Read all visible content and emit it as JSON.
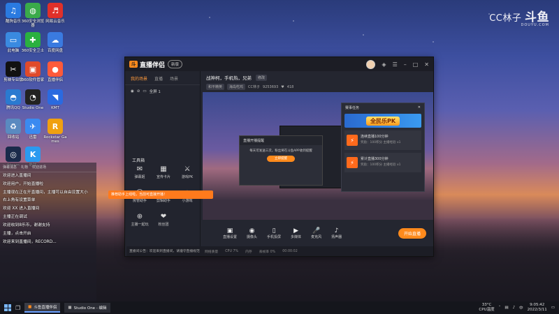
{
  "watermark": {
    "channel": "CC林子",
    "brand": "斗鱼",
    "domain": "DOUYU.COM"
  },
  "desktop_icons": [
    {
      "label": "酷狗音乐",
      "icon": "music-icon",
      "color": "#2a7ae0"
    },
    {
      "label": "360安全浏览器",
      "icon": "browser-icon",
      "color": "#3aaa4a"
    },
    {
      "label": "网易云音乐",
      "icon": "cloud-music-icon",
      "color": "#e0302a"
    },
    {
      "label": "此电脑",
      "icon": "computer-icon",
      "color": "#3a8ae0"
    },
    {
      "label": "360安全卫士",
      "icon": "shield-icon",
      "color": "#2ab040"
    },
    {
      "label": "百度网盘",
      "icon": "netdisk-icon",
      "color": "#3a7ae0"
    },
    {
      "label": "剪映专业版",
      "icon": "video-edit-icon",
      "color": "#111111"
    },
    {
      "label": "360软件管家",
      "icon": "app-store-icon",
      "color": "#e04a2a"
    },
    {
      "label": "直播伴侣",
      "icon": "live-icon",
      "color": "#ff5a3a"
    },
    {
      "label": "腾讯QQ",
      "icon": "qq-icon",
      "color": "#2a7ad0"
    },
    {
      "label": "Studio One",
      "icon": "studio-icon",
      "color": "#222222"
    },
    {
      "label": "KMT",
      "icon": "kmt-icon",
      "color": "#2a6ae0"
    },
    {
      "label": "回收站",
      "icon": "recycle-bin-icon",
      "color": "#5a8ac0"
    },
    {
      "label": "迅雷",
      "icon": "thunder-icon",
      "color": "#3a8af0"
    },
    {
      "label": "Rockstar Games",
      "icon": "rockstar-icon",
      "color": "#f0a010"
    },
    {
      "label": "Steam",
      "icon": "steam-icon",
      "color": "#1a2a4a"
    },
    {
      "label": "酷我",
      "icon": "kuwo-icon",
      "color": "#2a9af0"
    }
  ],
  "main_window": {
    "app_name": "直播伴侣",
    "version_badge": "新版",
    "left_tabs": [
      "我的场景",
      "直播",
      "场景"
    ],
    "scene_label": "全屏 1",
    "tools_title": "工具箱",
    "tools": [
      {
        "label": "弹幕姬",
        "icon": "danmaku-icon"
      },
      {
        "label": "宣传卡片",
        "icon": "card-icon"
      },
      {
        "label": "游戏PK",
        "icon": "pk-icon"
      },
      {
        "label": "房管助手",
        "icon": "manager-icon"
      },
      {
        "label": "剪辑助手",
        "icon": "clip-icon"
      },
      {
        "label": "小游戏",
        "icon": "game-icon"
      },
      {
        "label": "主播一起玩",
        "icon": "together-icon"
      },
      {
        "label": "粉丝团",
        "icon": "fans-icon"
      }
    ],
    "stream_title": "战神柯，手机热，兄弟",
    "edit_label": "修改",
    "tags": [
      "和平精英",
      "海岛吃鸡"
    ],
    "room_info": "CC林子",
    "room_id": "9253693",
    "viewer_count": "418",
    "dialog": {
      "title": "直播开播提醒",
      "body": "每天可发送三次，粉丝将在斗鱼APP收到提醒",
      "button": "立即提醒"
    },
    "rank_panel": {
      "title": "赛事任务",
      "banner": "全民乐PK",
      "tasks": [
        {
          "title": "连续直播100分钟",
          "detail": "奖励：100积分 主播经验 x1"
        },
        {
          "title": "累计直播300分钟",
          "detail": "奖励：100积分 主播经验 x1"
        }
      ]
    },
    "bottom_tools": [
      {
        "label": "直播设置",
        "icon": "settings-icon"
      },
      {
        "label": "摄像头",
        "icon": "camera-icon"
      },
      {
        "label": "手机投屏",
        "icon": "phone-icon"
      },
      {
        "label": "多媒体",
        "icon": "media-icon"
      },
      {
        "label": "麦克风",
        "icon": "mic-icon"
      },
      {
        "label": "扬声器",
        "icon": "speaker-icon"
      }
    ],
    "start_button": "开始直播",
    "orange_tip": "推荐助手上线啦，当前可直接开播！",
    "notice": "直播间公告：欢迎来到直播间，请遵守直播规范",
    "status": [
      "网络质量",
      "CPU 7%",
      "内存",
      "丢帧率 0%",
      "00:00:02"
    ]
  },
  "chat": {
    "header": [
      "弹幕消息",
      "礼物",
      "欢迎进场"
    ],
    "messages": [
      {
        "user": "",
        "text": "欢迎进入直播间"
      },
      {
        "user": "",
        "text": "欢迎用户，开始直播啦"
      },
      {
        "user": "",
        "text": "主播现在正在开直播间，主播可以自由设置大小"
      },
      {
        "user": "",
        "text": "右上角有设置菜单"
      },
      {
        "user": "",
        "text": "欢迎 XX 进入直播间"
      },
      {
        "user": "",
        "text": "主播正在调试"
      },
      {
        "user": "",
        "text": "欢迎收到8乐币，谢谢支持"
      },
      {
        "user": "",
        "text": "主播，点击开启"
      },
      {
        "user": "",
        "text": "欢迎来到直播间，RECORD..."
      }
    ]
  },
  "taskbar": {
    "apps": [
      "斗鱼直播伴侣",
      "Studio One - 编辑"
    ],
    "temp": "33°C",
    "cpu": "CPU温度",
    "time": "9:05:42",
    "date": "2022/3/11"
  }
}
